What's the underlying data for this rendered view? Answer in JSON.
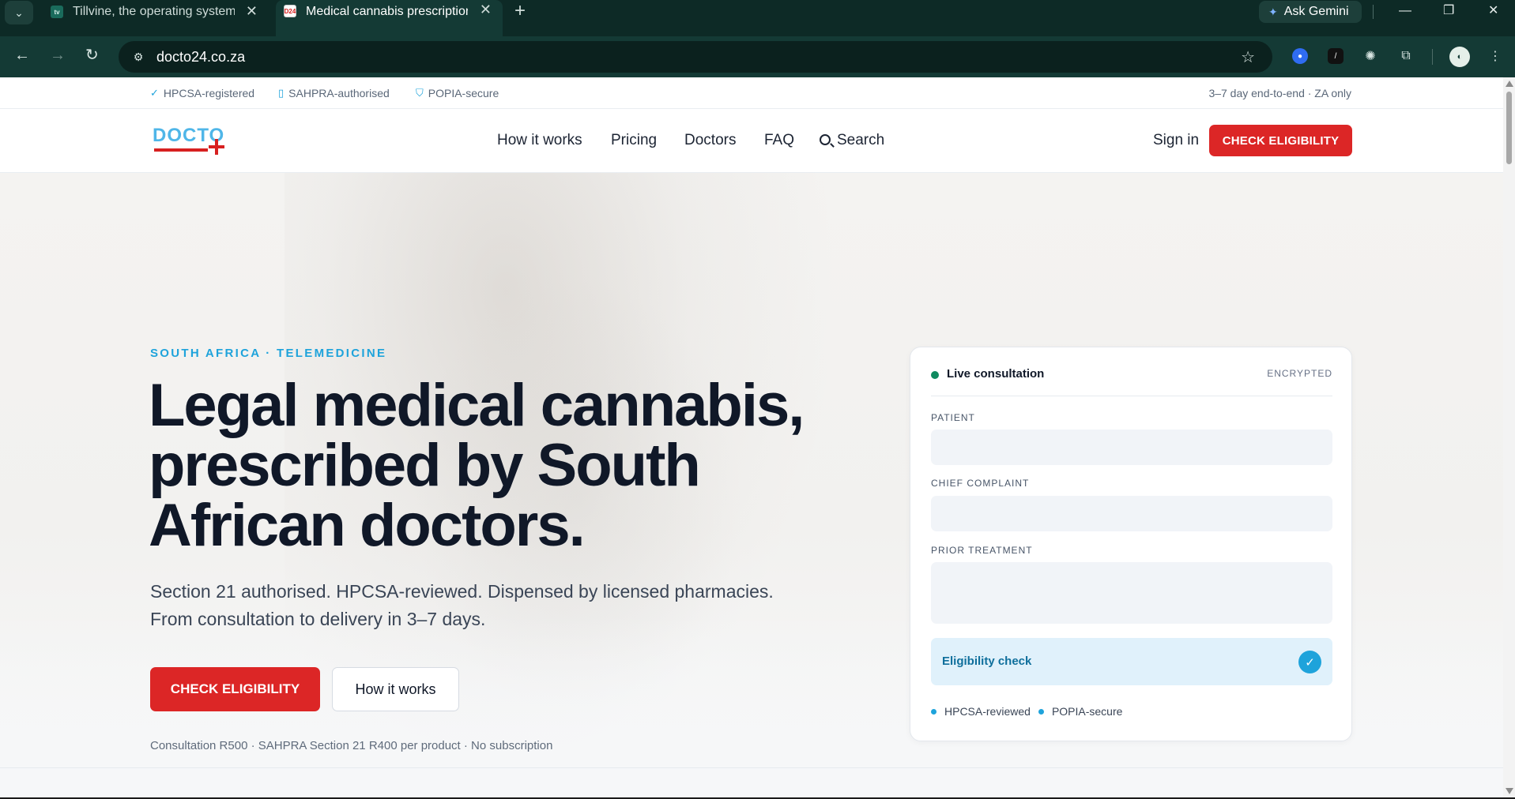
{
  "browser": {
    "tabs": [
      {
        "title": "Tillvine, the operating system fo",
        "favicon": "tv",
        "active": false
      },
      {
        "title": "Medical cannabis prescriptions",
        "favicon": "D24",
        "active": true
      }
    ],
    "new_tab": "+",
    "ask_gemini": "Ask Gemini",
    "url": "docto24.co.za",
    "icons": [
      "chevron-down-icon",
      "close-icon",
      "back-icon",
      "forward-icon",
      "reload-icon",
      "site-info-icon",
      "star-icon",
      "extension-icon",
      "menu-icon"
    ]
  },
  "topbar": {
    "trust_items": [
      "HPCSA-registered",
      "SAHPRA-authorised",
      "POPIA-secure"
    ],
    "right_note": "3–7 day end-to-end · ZA only"
  },
  "header": {
    "logo_word": "DOCTO",
    "nav": [
      "How it works",
      "Pricing",
      "Doctors",
      "FAQ",
      "Search"
    ],
    "sign_in": "Sign in",
    "cta": "CHECK ELIGIBILITY"
  },
  "hero": {
    "eyebrow": "SOUTH AFRICA · TELEMEDICINE",
    "headline_lines": [
      "Legal medical cannabis,",
      "prescribed by South",
      "African doctors."
    ],
    "subline_lines": [
      "Section 21 authorised. HPCSA-reviewed. Dispensed by licensed pharmacies.",
      "From consultation to delivery in 3–7 days."
    ],
    "cta_primary": "CHECK ELIGIBILITY",
    "cta_secondary": "How it works",
    "pricing_note": "Consultation R500 · SAHPRA Section 21 R400 per product · No subscription"
  },
  "card": {
    "live_label": "Live consultation",
    "encrypted": "ENCRYPTED",
    "fields": [
      "PATIENT",
      "CHIEF COMPLAINT",
      "PRIOR TREATMENT"
    ],
    "eligibility": "Eligibility check",
    "chips": [
      "HPCSA-reviewed",
      "POPIA-secure"
    ]
  },
  "colors": {
    "brand_red": "#dc2626",
    "brand_blue": "#1ea3db",
    "text_dark": "#101828",
    "chrome_dark": "#0d2a26"
  }
}
